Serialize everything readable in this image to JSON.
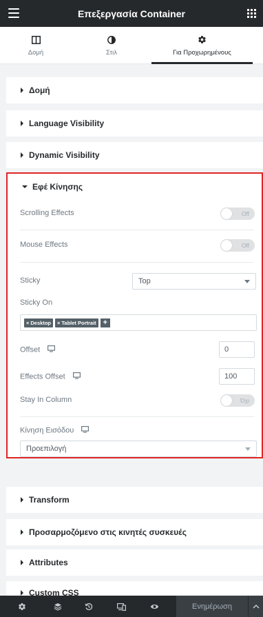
{
  "header": {
    "title": "Επεξεργασία Container",
    "menu_icon": "hamburger-icon",
    "apps_icon": "grid-icon"
  },
  "tabs": [
    {
      "label": "Δομή",
      "icon": "layout-icon"
    },
    {
      "label": "Στιλ",
      "icon": "half-circle-icon"
    },
    {
      "label": "Για Προχωρημένους",
      "icon": "gear-icon",
      "active": true
    }
  ],
  "sections": {
    "structure": "Δομή",
    "language_visibility": "Language Visibility",
    "dynamic_visibility": "Dynamic Visibility",
    "motion_effects": "Εφέ Κίνησης",
    "transform": "Transform",
    "responsive": "Προσαρμοζόμενο στις κινητές συσκευές",
    "attributes": "Attributes",
    "custom_css": "Custom CSS"
  },
  "motion": {
    "scrolling_effects": {
      "label": "Scrolling Effects",
      "state": "Off"
    },
    "mouse_effects": {
      "label": "Mouse Effects",
      "state": "Off"
    },
    "sticky": {
      "label": "Sticky",
      "value": "Top"
    },
    "sticky_on": {
      "label": "Sticky On",
      "tags": [
        "Desktop",
        "Tablet Portrait"
      ],
      "remove_glyph": "×",
      "add_glyph": "+"
    },
    "offset": {
      "label": "Offset",
      "value": "0"
    },
    "effects_offset": {
      "label": "Effects Offset",
      "value": "100"
    },
    "stay_in_column": {
      "label": "Stay In Column",
      "state": "Όχι"
    },
    "entrance": {
      "label": "Κίνηση Εισόδου",
      "value": "Προεπιλογή"
    }
  },
  "bottom": {
    "update_label": "Ενημέρωση"
  },
  "colors": {
    "header_bg": "#26292c",
    "panel_bg": "#f1f3f5",
    "highlight": "#e02424",
    "tag_bg": "#556068"
  }
}
